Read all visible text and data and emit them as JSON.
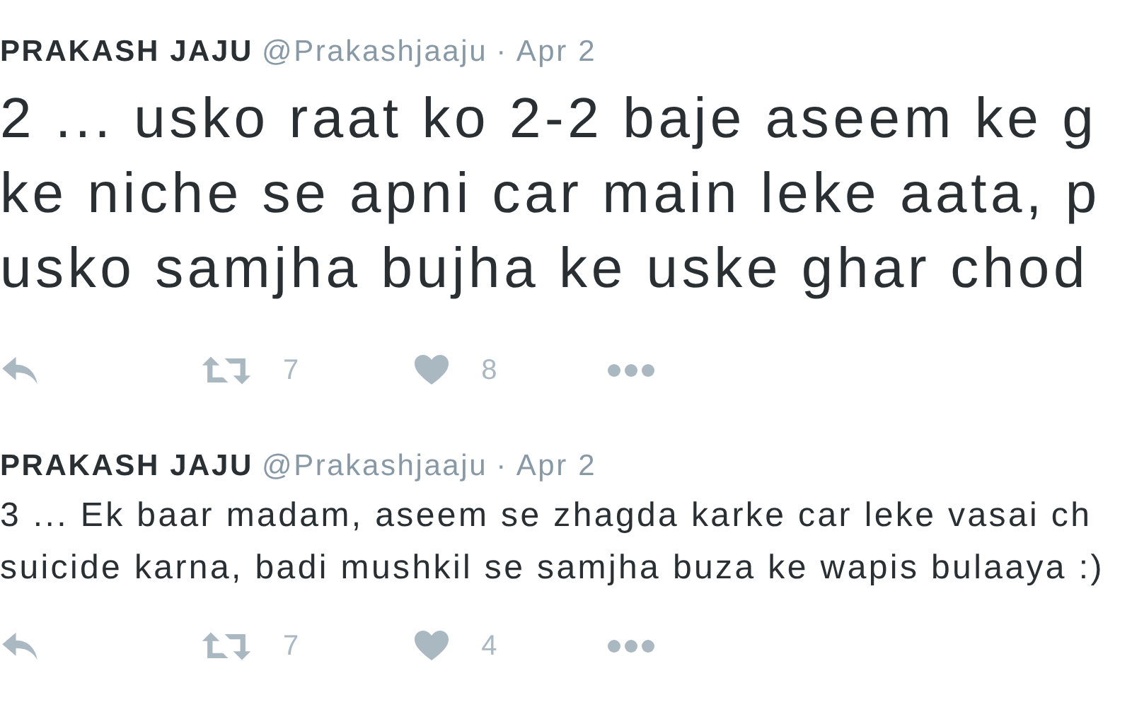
{
  "tweets": [
    {
      "name": "PRAKASH JAJU",
      "handle": "@Prakashjaaju",
      "date": "· Apr 2",
      "kind": "large",
      "lines": [
        "2 ... usko raat ko 2-2 baje aseem ke g",
        "ke niche se apni car main leke aata, p",
        "usko samjha bujha ke uske ghar chod"
      ],
      "retweets": "7",
      "likes": "8"
    },
    {
      "name": "PRAKASH JAJU",
      "handle": "@Prakashjaaju",
      "date": "· Apr 2",
      "kind": "normal",
      "lines": [
        "3 ... Ek baar madam, aseem se zhagda karke car leke vasai ch",
        "suicide karna, badi mushkil se samjha buza ke wapis bulaaya :)"
      ],
      "retweets": "7",
      "likes": "4"
    }
  ]
}
